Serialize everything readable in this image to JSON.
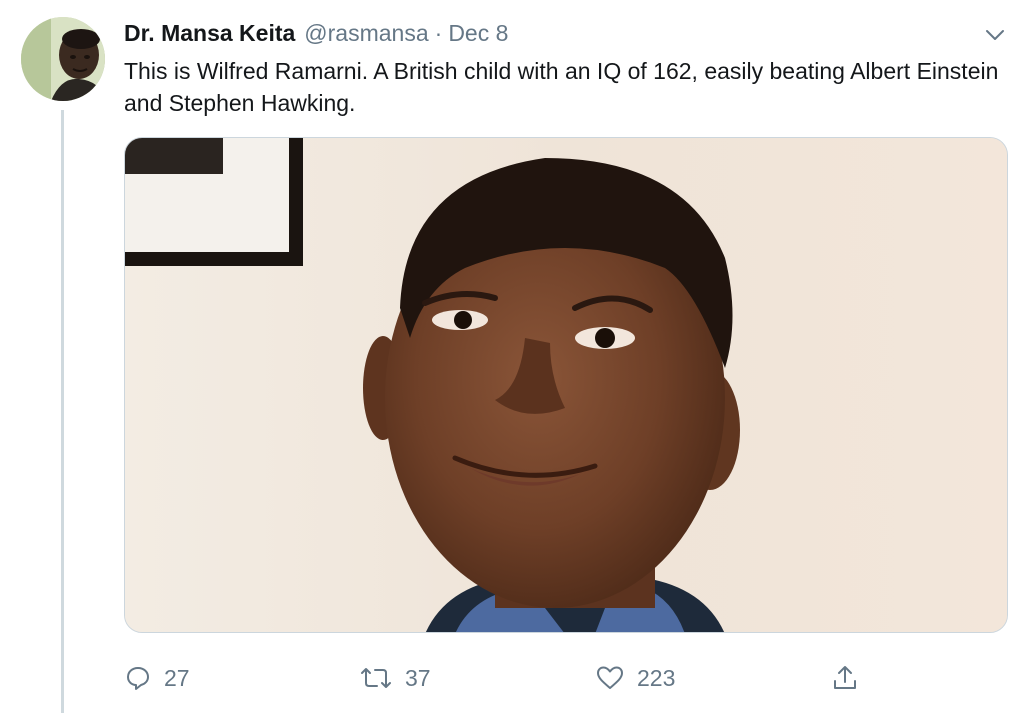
{
  "author": {
    "display_name": "Dr. Mansa Keita",
    "handle": "@rasmansa",
    "separator": "·",
    "date": "Dec 8"
  },
  "tweet": {
    "text": "This is Wilfred Ramarni. A British child with an IQ of 162, easily beating Albert Einstein and Stephen Hawking."
  },
  "media": {
    "type": "photo",
    "subject": "smiling boy portrait"
  },
  "actions": {
    "reply_count": "27",
    "retweet_count": "37",
    "like_count": "223"
  },
  "icons": {
    "more": "chevron-down-icon",
    "reply": "reply-icon",
    "retweet": "retweet-icon",
    "like": "heart-icon",
    "share": "share-icon"
  },
  "colors": {
    "text": "#14171a",
    "secondary": "#657786",
    "border": "#ccd6dd",
    "thread_line": "#cfd9de"
  }
}
